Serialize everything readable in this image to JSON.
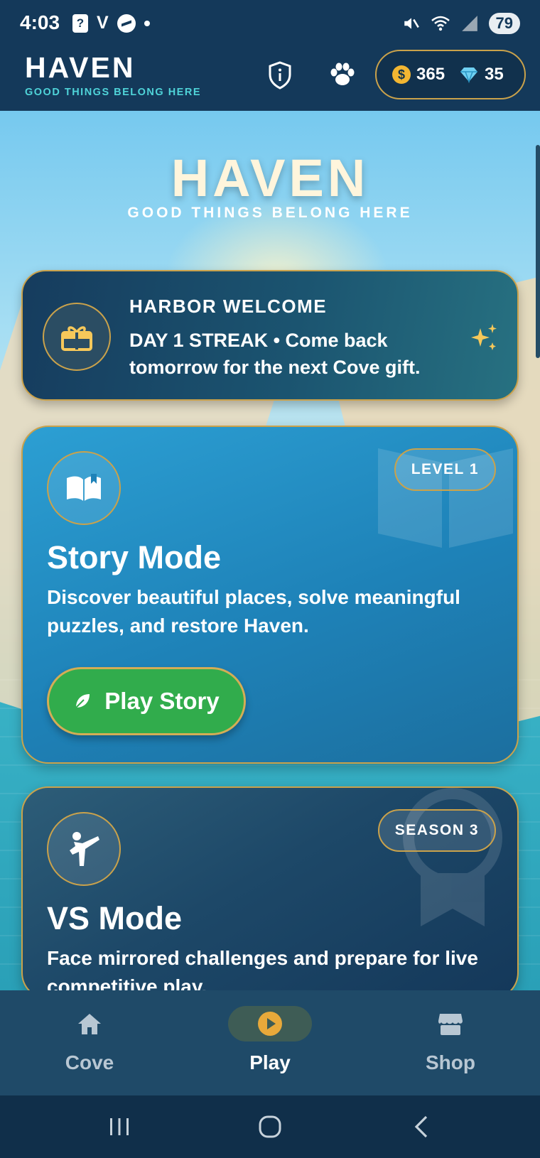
{
  "status_bar": {
    "time": "4:03",
    "notif_box": "?",
    "notif_v": "V",
    "battery": "79"
  },
  "header": {
    "title": "HAVEN",
    "tagline": "GOOD THINGS BELONG HERE",
    "coins": "365",
    "gems": "35",
    "coin_symbol": "$",
    "icons": [
      "shield-info-icon",
      "paw-icon",
      "coin-icon",
      "gem-icon"
    ]
  },
  "hero": {
    "title": "HAVEN",
    "tagline": "GOOD THINGS BELONG HERE"
  },
  "welcome": {
    "title": "HARBOR WELCOME",
    "body": "DAY 1 STREAK  •  Come back tomorrow for the next Cove gift."
  },
  "story_mode": {
    "badge": "LEVEL 1",
    "title": "Story Mode",
    "description": "Discover beautiful places, solve meaningful puzzles, and restore Haven.",
    "button_label": "Play Story"
  },
  "vs_mode": {
    "badge": "SEASON 3",
    "title": "VS Mode",
    "description": "Face mirrored challenges and prepare for live competitive play."
  },
  "bottom_nav": {
    "items": [
      {
        "label": "Cove",
        "icon": "home-icon"
      },
      {
        "label": "Play",
        "icon": "play-icon",
        "active": true
      },
      {
        "label": "Shop",
        "icon": "shop-icon"
      }
    ]
  },
  "colors": {
    "header_bg": "#14395a",
    "accent_gold": "#caa24b",
    "tagline_teal": "#4fd3d8",
    "play_green": "#31ac4c",
    "story_blue": "#1e82b8"
  }
}
